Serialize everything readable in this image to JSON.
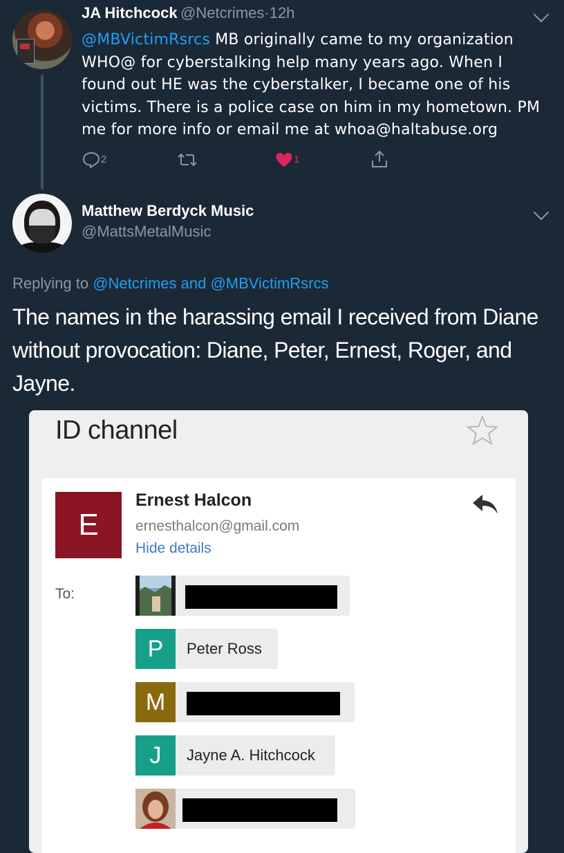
{
  "tweet1": {
    "display_name": "JA Hitchcock",
    "handle": "@Netcrimes",
    "separator": "·",
    "time": "12h",
    "mention": "@MBVictimRsrcs",
    "text_lines": [
      " MB originally came to my organization",
      "WHO@ for cyberstalking help many years ago. When I",
      "found out HE was the cyberstalker, I became one of his",
      "victims. There is a police case on him in my hometown. PM",
      "me for  more info or email me at whoa@haltabuse.org"
    ],
    "reply_count": "2",
    "like_count": "1",
    "icons": [
      "reply-icon",
      "retweet-icon",
      "like-icon",
      "share-icon"
    ]
  },
  "tweet2": {
    "display_name": "Matthew Berdyck Music",
    "handle": "@MattsMetalMusic",
    "replying_prefix": "Replying to ",
    "replying_to_1": "@Netcrimes",
    "replying_and": " and ",
    "replying_to_2": "@MBVictimRsrcs",
    "text_lines": [
      "The names in the harassing email I received from Diane",
      "without provocation: Diane, Peter, Ernest, Roger, and",
      "Jayne."
    ]
  },
  "email": {
    "title": "ID channel",
    "sender_initial": "E",
    "sender_name": "Ernest Halcon",
    "sender_email": "ernesthalcon@gmail.com",
    "hide_details": "Hide details",
    "to_label": "To:",
    "recipients": [
      {
        "initial": "",
        "name": "",
        "redacted": true,
        "photo": true
      },
      {
        "initial": "P",
        "name": "Peter Ross",
        "redacted": false,
        "color": "#16a08a"
      },
      {
        "initial": "M",
        "name": "",
        "redacted": true,
        "color": "#8a6a0c"
      },
      {
        "initial": "J",
        "name": "Jayne A. Hitchcock",
        "redacted": false,
        "color": "#16a08a"
      },
      {
        "initial": "",
        "name": "",
        "redacted": true,
        "photo": true
      }
    ]
  },
  "colors": {
    "background": "#1b2836",
    "link": "#1da1f2",
    "like": "#e0245e",
    "secondary_text": "#8899a6",
    "sender_tile": "#8a1524"
  }
}
